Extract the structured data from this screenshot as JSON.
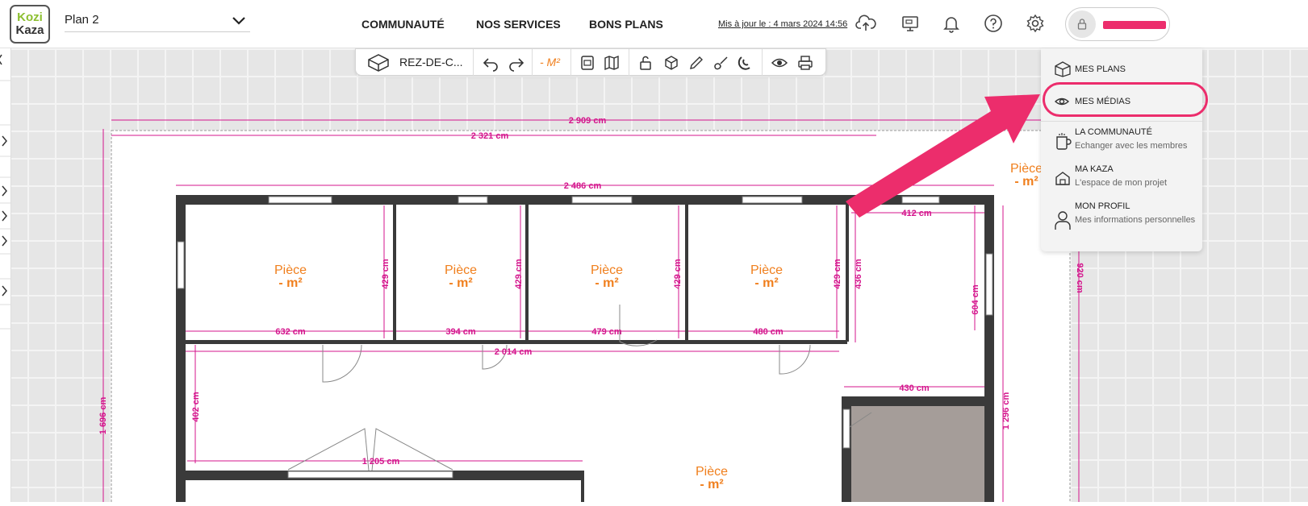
{
  "header": {
    "logo_line1": "Kozi",
    "logo_line2": "Kaza",
    "plan_name": "Plan 2",
    "nav": [
      "COMMUNAUTÉ",
      "NOS SERVICES",
      "BONS PLANS"
    ],
    "updated": "Mis à jour le : 4 mars 2024 14:56"
  },
  "toolbar": {
    "level": "REZ-DE-C...",
    "area_toggle": "- M²"
  },
  "user_menu": {
    "items": [
      {
        "title": "MES PLANS",
        "subtitle": ""
      },
      {
        "title": "MES MÉDIAS",
        "subtitle": ""
      },
      {
        "title": "LA COMMUNAUTÉ",
        "subtitle": "Echanger avec les membres"
      },
      {
        "title": "MA KAZA",
        "subtitle": "L'espace de mon projet"
      },
      {
        "title": "MON PROFIL",
        "subtitle": "Mes informations personnelles"
      }
    ]
  },
  "plan": {
    "room_label": "Pièce",
    "room_area": "- m²",
    "dimensions": {
      "total_width": "2 909 cm",
      "inner_width": "2 321 cm",
      "wall_width": "2 486 cm",
      "total_height": "1 696 cm",
      "right_height": "920 cm",
      "right_height2": "1 296 cm",
      "room1_w": "632 cm",
      "room2_w": "394 cm",
      "room3_w": "479 cm",
      "room4_w": "480 cm",
      "room5_w": "412 cm",
      "room_h": "429 cm",
      "room5_h": "436 cm",
      "right_side_h": "604 cm",
      "corridor_w": "2 014 cm",
      "corridor_h": "402 cm",
      "lower_w": "1 205 cm",
      "annex_w": "430 cm"
    }
  },
  "colors": {
    "accent": "#ec2d6c",
    "dimension": "#d4148c",
    "room_label": "#f07f1d",
    "brand_green": "#8cbf2f"
  }
}
